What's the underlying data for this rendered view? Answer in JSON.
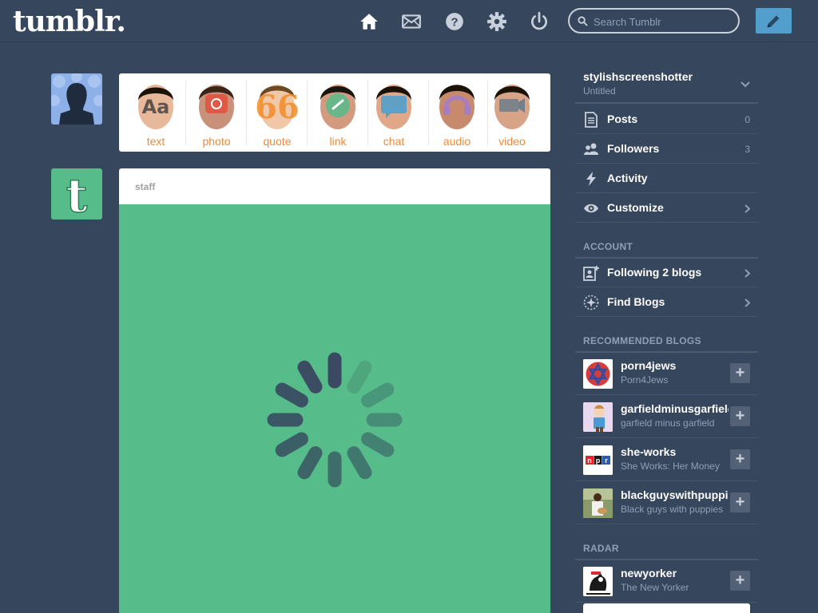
{
  "header": {
    "logo": "tumblr.",
    "search": {
      "placeholder": "Search Tumblr",
      "value": ""
    },
    "nav_icons": [
      "home-icon",
      "mail-icon",
      "help-icon",
      "gear-icon",
      "power-icon"
    ],
    "compose_icon": "pencil-icon"
  },
  "post_types": [
    {
      "label": "text",
      "icon": "text-icon",
      "color": "#ec8b3b"
    },
    {
      "label": "photo",
      "icon": "camera-icon",
      "color": "#e64a3a"
    },
    {
      "label": "quote",
      "icon": "quote-icon",
      "color": "#f28c28"
    },
    {
      "label": "link",
      "icon": "link-icon",
      "color": "#56bc8a"
    },
    {
      "label": "chat",
      "icon": "chat-icon",
      "color": "#529ecc"
    },
    {
      "label": "audio",
      "icon": "headphones-icon",
      "color": "#a77dc2"
    },
    {
      "label": "video",
      "icon": "video-camera-icon",
      "color": "#748089"
    }
  ],
  "post": {
    "author": "staff",
    "media_color": "#56bc8a"
  },
  "sidebar": {
    "blog": {
      "name": "stylishscreenshotter",
      "title": "Untitled"
    },
    "items": [
      {
        "label": "Posts",
        "count": "0",
        "icon": "document-icon"
      },
      {
        "label": "Followers",
        "count": "3",
        "icon": "followers-icon"
      },
      {
        "label": "Activity",
        "count": "",
        "icon": "lightning-icon"
      },
      {
        "label": "Customize",
        "count": "",
        "icon": "eye-icon"
      }
    ],
    "account_heading": "ACCOUNT",
    "account_items": [
      {
        "label": "Following 2 blogs",
        "icon": "following-icon"
      },
      {
        "label": "Find Blogs",
        "icon": "compass-icon"
      }
    ],
    "recommended_heading": "RECOMMENDED BLOGS",
    "recommended": [
      {
        "name": "porn4jews",
        "title": "Porn4Jews"
      },
      {
        "name": "garfieldminusgarfield",
        "title": "garfield minus garfield"
      },
      {
        "name": "she-works",
        "title": "She Works: Her Money"
      },
      {
        "name": "blackguyswithpuppies",
        "title": "Black guys with puppies"
      }
    ],
    "radar_heading": "RADAR",
    "radar": [
      {
        "name": "newyorker",
        "title": "The New Yorker"
      }
    ]
  },
  "colors": {
    "background": "#36465d",
    "compose": "#529ecc",
    "post_type_label": "#ec8b3b"
  }
}
